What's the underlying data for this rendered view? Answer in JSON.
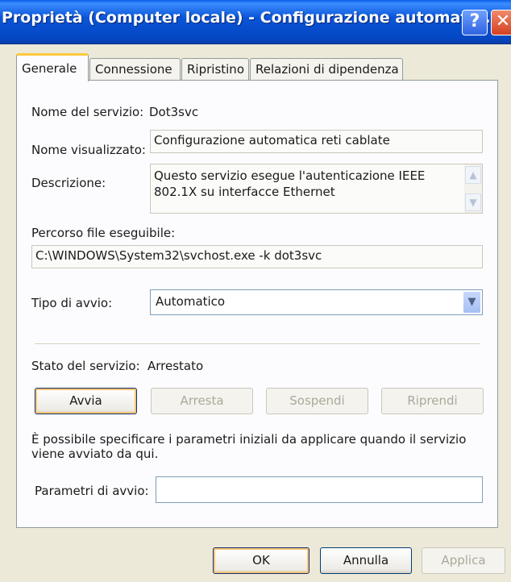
{
  "window": {
    "title": "Proprietà (Computer locale) - Configurazione automati...",
    "help_glyph": "?",
    "close_glyph": "✕"
  },
  "tabs": [
    {
      "label": "Generale",
      "active": true
    },
    {
      "label": "Connessione",
      "active": false
    },
    {
      "label": "Ripristino",
      "active": false
    },
    {
      "label": "Relazioni di dipendenza",
      "active": false
    }
  ],
  "general": {
    "service_name_label": "Nome del servizio:",
    "service_name_value": "Dot3svc",
    "display_name_label": "Nome visualizzato:",
    "display_name_value": "Configurazione automatica reti cablate",
    "description_label": "Descrizione:",
    "description_value": "Questo servizio esegue l'autenticazione IEEE 802.1X su interfacce Ethernet",
    "exec_path_label": "Percorso file eseguibile:",
    "exec_path_value": "C:\\WINDOWS\\System32\\svchost.exe -k dot3svc",
    "startup_type_label": "Tipo di avvio:",
    "startup_type_value": "Automatico",
    "status_label": "Stato del servizio:",
    "status_value": "Arrestato",
    "info_text": "È possibile specificare i parametri iniziali da applicare quando il servizio viene avviato da qui.",
    "start_params_label": "Parametri di avvio:",
    "start_params_value": ""
  },
  "service_buttons": {
    "start": "Avvia",
    "stop": "Arresta",
    "pause": "Sospendi",
    "resume": "Riprendi"
  },
  "dialog_buttons": {
    "ok": "OK",
    "cancel": "Annulla",
    "apply": "Applica"
  },
  "icons": {
    "scroll_up": "scroll-up-arrow-icon",
    "scroll_down": "scroll-down-arrow-icon",
    "dropdown": "chevron-down-icon"
  },
  "colors": {
    "titlebar": "#0a55d8",
    "active_tab_highlight": "#ffc83c",
    "close_button": "#d44020",
    "dialog_background": "#ece9d8"
  }
}
